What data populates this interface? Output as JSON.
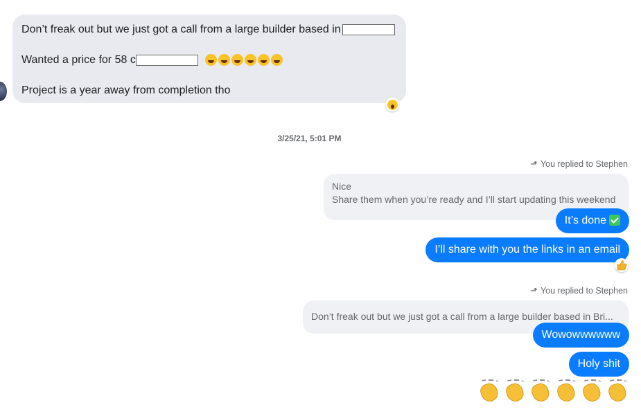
{
  "incoming": {
    "lines": [
      "Don’t freak out but we just got a call from a large builder based in",
      "Wanted a price for 58 c",
      "Project is a year away from completion tho"
    ],
    "reaction": "wow-emoji"
  },
  "timestamp": "3/25/21, 5:01 PM",
  "thread": [
    {
      "replied_label": "You replied to Stephen",
      "quote_lines": [
        "Nice",
        "Share them when you’re ready and I’ll start updating this weekend"
      ],
      "messages": [
        "It’s done",
        "I’ll share with you the links in an email"
      ],
      "reaction": "thumbs-up-emoji"
    },
    {
      "replied_label": "You replied to Stephen",
      "quote_lines": [
        "Don’t freak out but we just got a call from a large builder based in Bri..."
      ],
      "messages": [
        "Wowowwwwww",
        "Holy shit"
      ],
      "emoji_count": 6
    }
  ]
}
